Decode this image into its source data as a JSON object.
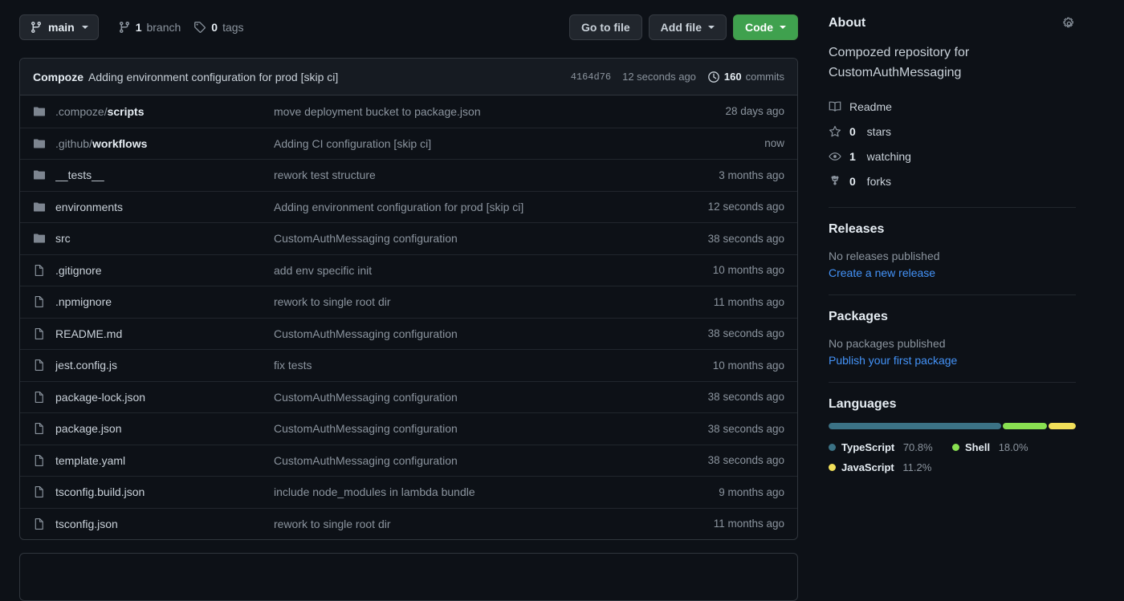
{
  "toolbar": {
    "branch_label": "main",
    "branch_icon": "git-branch-icon",
    "branches": {
      "count": "1",
      "label": "branch",
      "icon": "git-branch-icon"
    },
    "tags": {
      "count": "0",
      "label": "tags",
      "icon": "tag-icon"
    },
    "go_to_file": "Go to file",
    "add_file": "Add file",
    "code": "Code"
  },
  "commit_header": {
    "author": "Compoze",
    "message": "Adding environment configuration for prod [skip ci]",
    "sha": "4164d76",
    "time": "12 seconds ago",
    "commits_count": "160",
    "commits_label": "commits",
    "history_icon": "history-icon"
  },
  "files": [
    {
      "type": "folder",
      "icon": "folder-icon",
      "prefix": ".compoze/",
      "name": "scripts",
      "message": "move deployment bucket to package.json",
      "time": "28 days ago"
    },
    {
      "type": "folder",
      "icon": "folder-icon",
      "prefix": ".github/",
      "name": "workflows",
      "message": "Adding CI configuration [skip ci]",
      "time": "now"
    },
    {
      "type": "folder",
      "icon": "folder-icon",
      "prefix": "",
      "name": "__tests__",
      "message": "rework test structure",
      "time": "3 months ago"
    },
    {
      "type": "folder",
      "icon": "folder-icon",
      "prefix": "",
      "name": "environments",
      "message": "Adding environment configuration for prod [skip ci]",
      "time": "12 seconds ago"
    },
    {
      "type": "folder",
      "icon": "folder-icon",
      "prefix": "",
      "name": "src",
      "message": "CustomAuthMessaging configuration",
      "time": "38 seconds ago"
    },
    {
      "type": "file",
      "icon": "file-icon",
      "prefix": "",
      "name": ".gitignore",
      "message": "add env specific init",
      "time": "10 months ago"
    },
    {
      "type": "file",
      "icon": "file-icon",
      "prefix": "",
      "name": ".npmignore",
      "message": "rework to single root dir",
      "time": "11 months ago"
    },
    {
      "type": "file",
      "icon": "file-icon",
      "prefix": "",
      "name": "README.md",
      "message": "CustomAuthMessaging configuration",
      "time": "38 seconds ago"
    },
    {
      "type": "file",
      "icon": "file-icon",
      "prefix": "",
      "name": "jest.config.js",
      "message": "fix tests",
      "time": "10 months ago"
    },
    {
      "type": "file",
      "icon": "file-icon",
      "prefix": "",
      "name": "package-lock.json",
      "message": "CustomAuthMessaging configuration",
      "time": "38 seconds ago"
    },
    {
      "type": "file",
      "icon": "file-icon",
      "prefix": "",
      "name": "package.json",
      "message": "CustomAuthMessaging configuration",
      "time": "38 seconds ago"
    },
    {
      "type": "file",
      "icon": "file-icon",
      "prefix": "",
      "name": "template.yaml",
      "message": "CustomAuthMessaging configuration",
      "time": "38 seconds ago"
    },
    {
      "type": "file",
      "icon": "file-icon",
      "prefix": "",
      "name": "tsconfig.build.json",
      "message": "include node_modules in lambda bundle",
      "time": "9 months ago"
    },
    {
      "type": "file",
      "icon": "file-icon",
      "prefix": "",
      "name": "tsconfig.json",
      "message": "rework to single root dir",
      "time": "11 months ago"
    }
  ],
  "sidebar": {
    "about": {
      "title": "About",
      "gear_icon": "gear-icon",
      "description": "Compozed repository for CustomAuthMessaging"
    },
    "links": [
      {
        "icon": "book-icon",
        "label": "Readme",
        "count": ""
      },
      {
        "icon": "star-icon",
        "count": "0",
        "label": "stars"
      },
      {
        "icon": "eye-icon",
        "count": "1",
        "label": "watching"
      },
      {
        "icon": "fork-icon",
        "count": "0",
        "label": "forks"
      }
    ],
    "releases": {
      "title": "Releases",
      "empty": "No releases published",
      "action": "Create a new release"
    },
    "packages": {
      "title": "Packages",
      "empty": "No packages published",
      "action": "Publish your first package"
    },
    "languages": {
      "title": "Languages",
      "items": [
        {
          "name": "TypeScript",
          "percent": "70.8%",
          "value": 70.8,
          "color": "#3b7285"
        },
        {
          "name": "Shell",
          "percent": "18.0%",
          "value": 18.0,
          "color": "#89e051"
        },
        {
          "name": "JavaScript",
          "percent": "11.2%",
          "value": 11.2,
          "color": "#f1e05a"
        }
      ]
    }
  }
}
